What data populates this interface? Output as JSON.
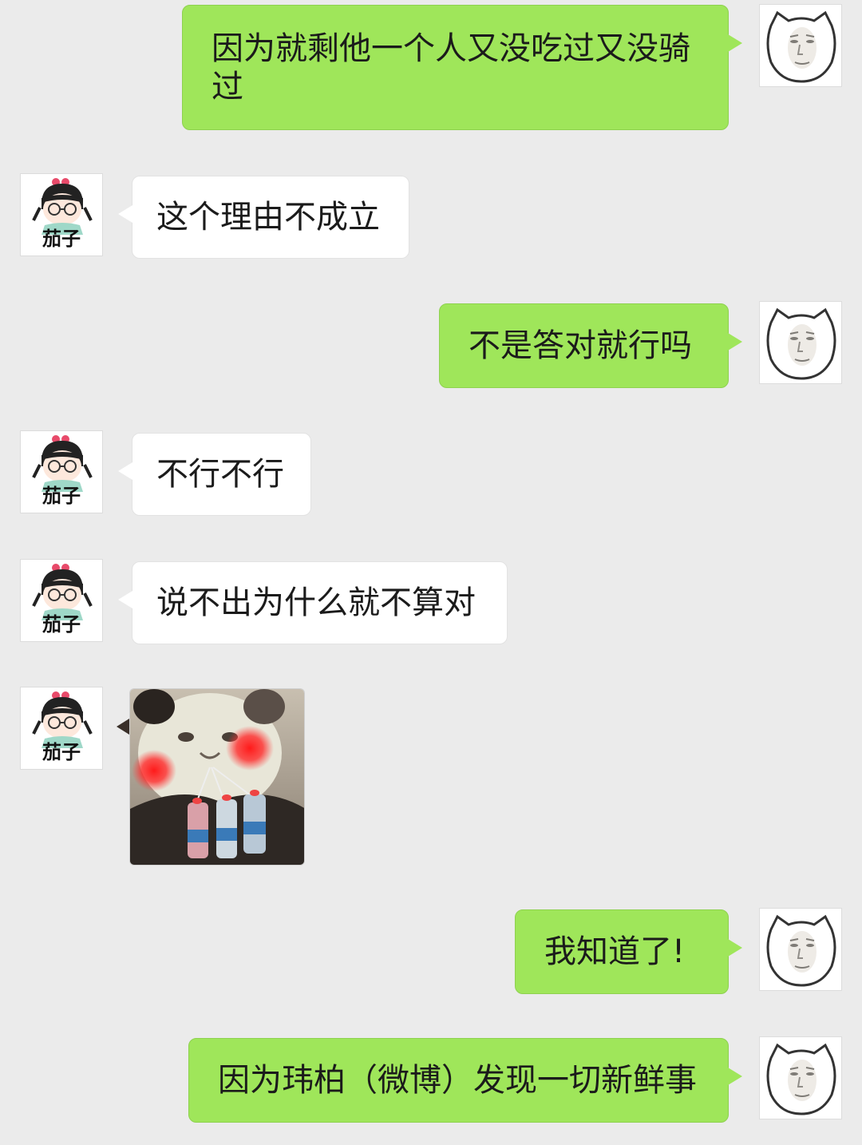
{
  "chat": {
    "contact_avatar_label": "茄子",
    "messages": [
      {
        "sender": "me",
        "kind": "text",
        "text": "因为就剩他一个人又没吃过又没骑过"
      },
      {
        "sender": "contact",
        "kind": "text",
        "text": "这个理由不成立"
      },
      {
        "sender": "me",
        "kind": "text",
        "text": "不是答对就行吗"
      },
      {
        "sender": "contact",
        "kind": "text",
        "text": "不行不行"
      },
      {
        "sender": "contact",
        "kind": "text",
        "text": "说不出为什么就不算对"
      },
      {
        "sender": "contact",
        "kind": "sticker",
        "sticker": "panda-meme-sticker"
      },
      {
        "sender": "me",
        "kind": "text",
        "text": "我知道了!"
      },
      {
        "sender": "me",
        "kind": "text",
        "text": "因为玮柏（微博）发现一切新鲜事"
      }
    ]
  },
  "colors": {
    "background": "#ebebeb",
    "outgoing_bubble": "#9fe65a",
    "incoming_bubble": "#ffffff"
  }
}
